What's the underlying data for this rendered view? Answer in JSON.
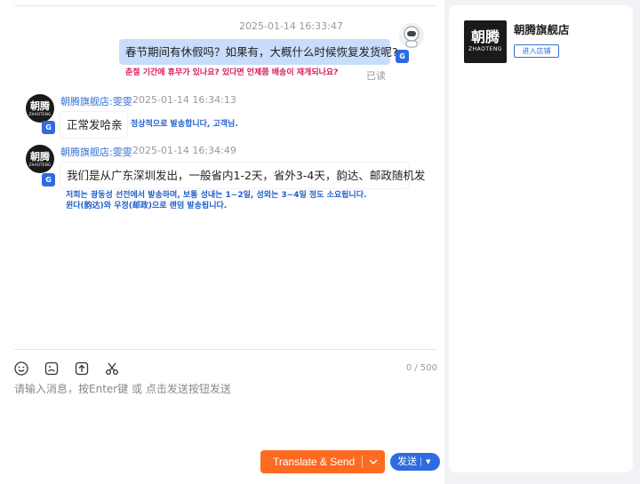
{
  "conversation": {
    "outgoing": {
      "timestamp": "2025-01-14 16:33:47",
      "text": "春节期间有休假吗？如果有，大概什么时候恢复发货呢?",
      "translation": "춘절 기간에 휴무가 있나요? 있다면 언제쯤 배송이 재개되나요?",
      "read_status": "已读"
    },
    "incoming": [
      {
        "sender": "朝腾旗舰店:雯雯",
        "timestamp": "2025-01-14 16:34:13",
        "text": "正常发哈亲",
        "translation": [
          "정상적으로 발송합니다, 고객님."
        ]
      },
      {
        "sender": "朝腾旗舰店:雯雯",
        "timestamp": "2025-01-14 16:34:49",
        "text": "我们是从广东深圳发出，一般省内1-2天，省外3-4天，韵达、邮政随机发",
        "translation": [
          "저희는 광동성 선전에서 발송하며, 보통 성내는 1~2일, 성외는 3~4일 정도 소요됩니다.",
          "윈다(韵达)와 우정(邮政)으로 랜덤 발송됩니다."
        ]
      }
    ]
  },
  "avatar_text": {
    "big": "朝腾",
    "small": "ZHAOTENG"
  },
  "translate_badge": "G",
  "input": {
    "tools": [
      "emoji-icon",
      "image-icon",
      "upload-icon",
      "scissors-icon"
    ],
    "char_count": "0 / 500",
    "placeholder": "请输入消息，按Enter键 或 点击发送按钮发送",
    "translate_send_label": "Translate & Send",
    "send_label": "发送",
    "send_caret": "▼"
  },
  "shop": {
    "name": "朝腾旗舰店",
    "logo_big": "朝腾",
    "logo_small": "ZHAOTENG",
    "enter_label": "进入店铺"
  },
  "colors": {
    "outgoing_bubble": "#c7ddfb",
    "translate_send": "#ff6a21",
    "send": "#2f6be0",
    "translation_out": "#d6195c",
    "translation_in": "#1f5fc8",
    "sender_name": "#3571d6"
  }
}
